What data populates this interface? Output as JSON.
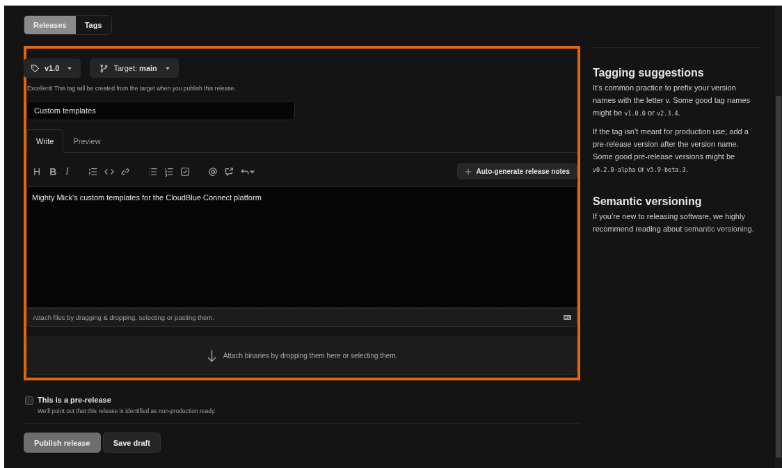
{
  "top_tabs": [
    {
      "label": "Releases",
      "selected": true
    },
    {
      "label": "Tags",
      "selected": false
    }
  ],
  "tag_button": {
    "label": "v1.0"
  },
  "target_button": {
    "label": "Target:",
    "value": "main"
  },
  "tag_hint": "Excellent! This tag will be created from the target when you publish this release.",
  "title_field": {
    "value": "Custom templates"
  },
  "editor_tabs": [
    {
      "label": "Write",
      "selected": true
    },
    {
      "label": "Preview",
      "selected": false
    }
  ],
  "toolbar_letters": [
    "H",
    "B",
    "I"
  ],
  "auto_generate_button": {
    "label": "Auto-generate release notes"
  },
  "body_field": {
    "value": "Mighty Mick's custom templates for the CloudBlue Connect platform"
  },
  "attach_hint": "Attach files by dragging & dropping, selecting or pasting them.",
  "binaries_hint": "Attach binaries by dropping them here or selecting them.",
  "prerelease": {
    "label": "This is a pre-release",
    "checked": false,
    "description": "We'll point out that this release is identified as non-production ready."
  },
  "buttons": [
    {
      "label": "Publish release",
      "kind": "primary"
    },
    {
      "label": "Save draft",
      "kind": "secondary"
    }
  ],
  "sidebar": [
    {
      "heading": "Tagging suggestions",
      "paragraphs": [
        [
          {
            "kind": "text",
            "text": "It’s common practice to prefix your version names with the letter v. Some good tag names might be "
          },
          {
            "kind": "code",
            "text": "v1.0.0"
          },
          {
            "kind": "text",
            "text": " or "
          },
          {
            "kind": "code",
            "text": "v2.3.4"
          },
          {
            "kind": "text",
            "text": "."
          }
        ],
        [
          {
            "kind": "text",
            "text": "If the tag isn’t meant for production use, add a pre-release version after the version name. Some good pre-release versions might be "
          },
          {
            "kind": "code",
            "text": "v0.2.0-alpha"
          },
          {
            "kind": "text",
            "text": " or "
          },
          {
            "kind": "code",
            "text": "v5.9-beta.3"
          },
          {
            "kind": "text",
            "text": "."
          }
        ]
      ]
    },
    {
      "heading": "Semantic versioning",
      "paragraphs": [
        [
          {
            "kind": "text",
            "text": "If you’re new to releasing software, we highly recommend reading about "
          },
          {
            "kind": "link",
            "text": "semantic versioning"
          },
          {
            "kind": "text",
            "text": "."
          }
        ]
      ]
    }
  ]
}
